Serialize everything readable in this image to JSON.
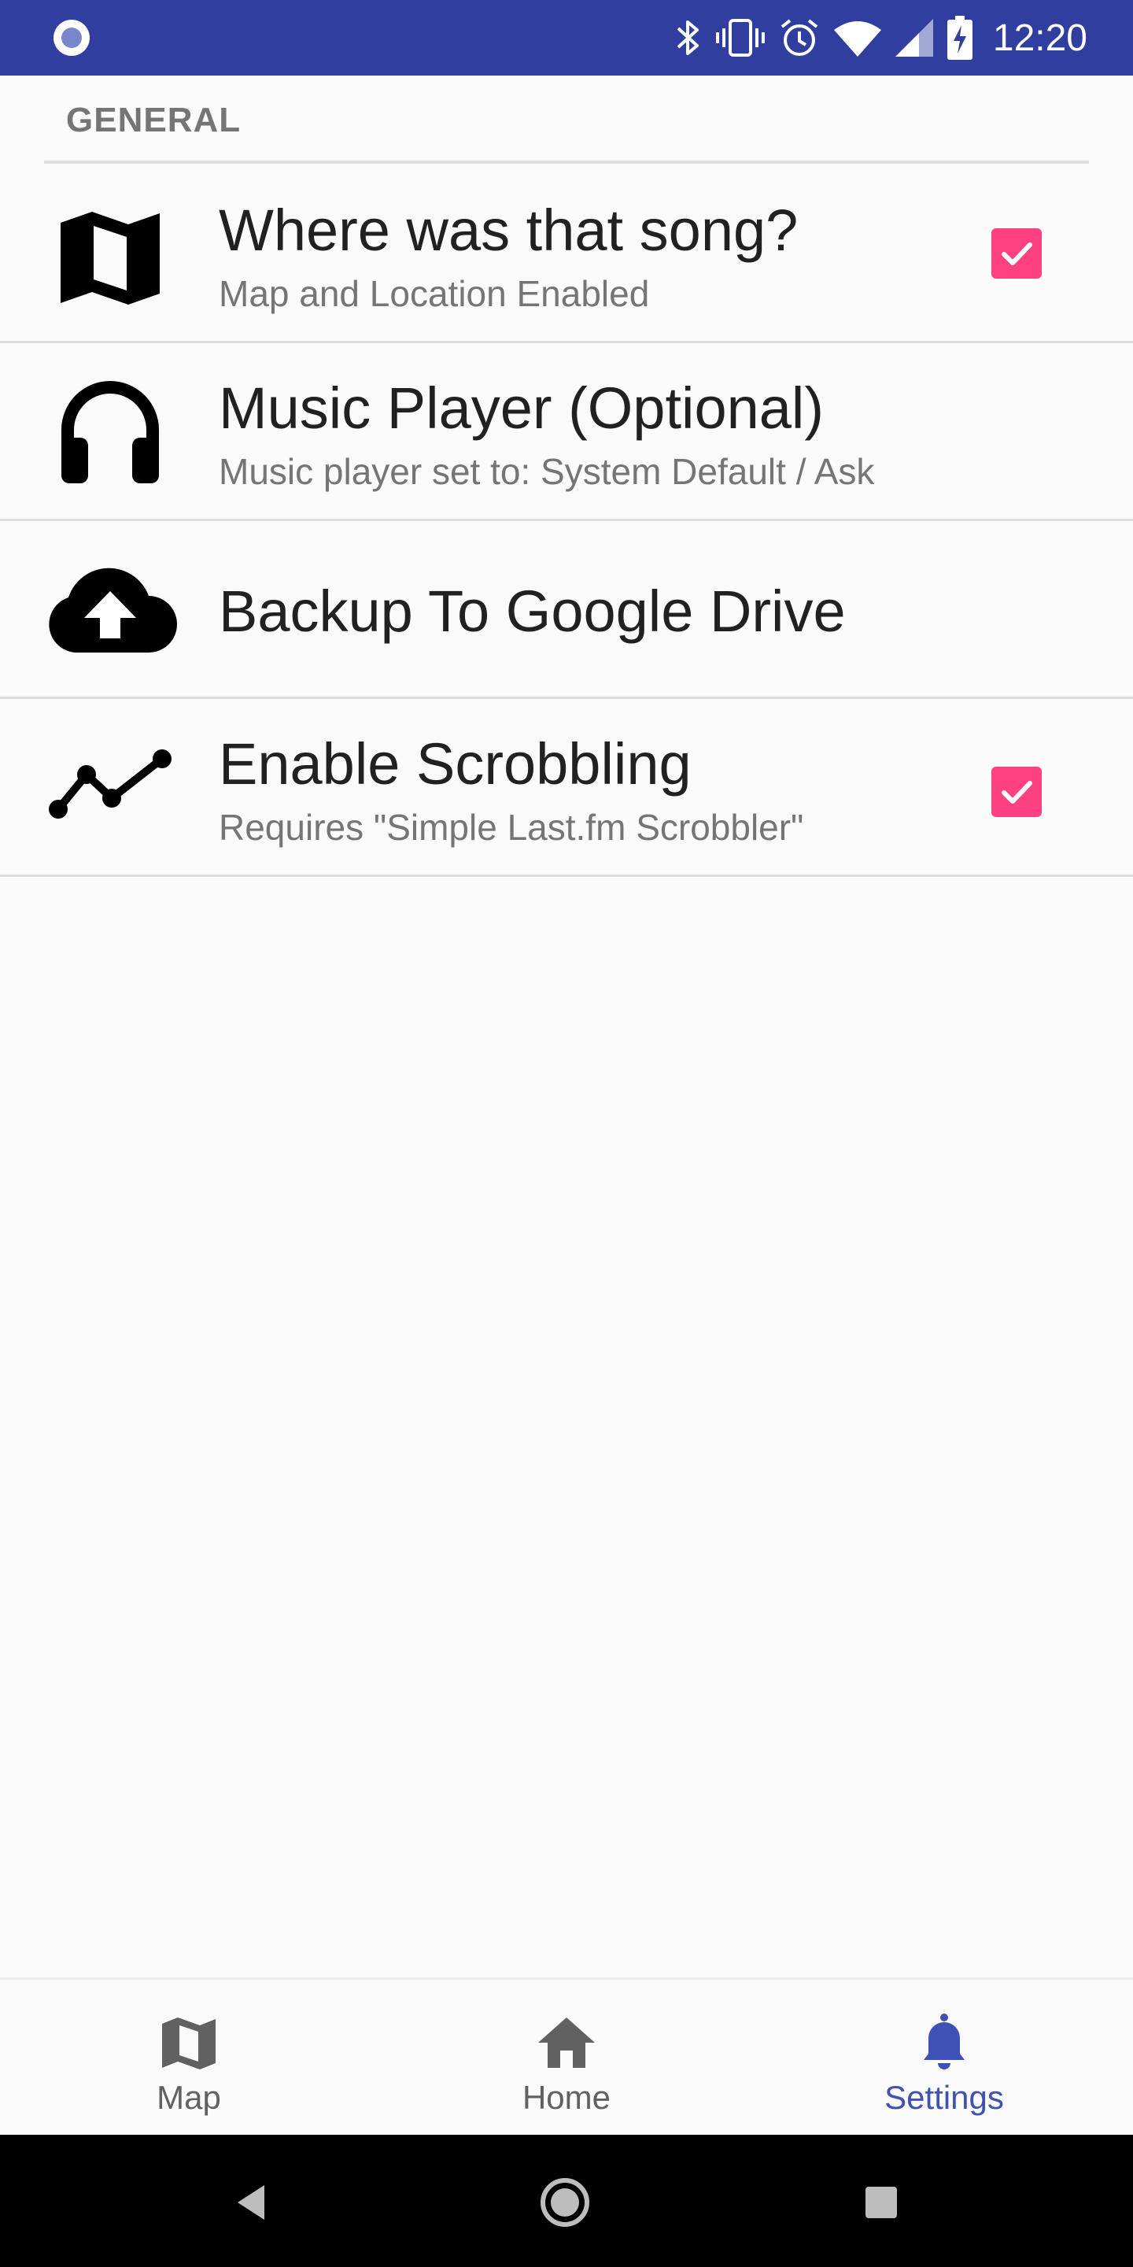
{
  "status_bar": {
    "time": "12:20",
    "background_color": "#303f9f",
    "icons": [
      "app-notification-icon",
      "bluetooth-icon",
      "vibrate-icon",
      "alarm-icon",
      "wifi-icon",
      "cell-signal-icon",
      "battery-charging-icon"
    ]
  },
  "settings": {
    "section_header": "GENERAL",
    "items": [
      {
        "title": "Where was that song?",
        "summary": "Map and Location Enabled",
        "icon": "map-icon",
        "checked": true
      },
      {
        "title": "Music Player (Optional)",
        "summary": "Music player set to: System Default / Ask",
        "icon": "headphones-icon"
      },
      {
        "title": "Backup To Google Drive",
        "icon": "cloud-upload-icon"
      },
      {
        "title": "Enable Scrobbling",
        "summary": "Requires \"Simple Last.fm Scrobbler\"",
        "icon": "trending-line-icon",
        "checked": true
      }
    ],
    "checkbox_color": "#ff4081"
  },
  "bottom_nav": {
    "items": [
      {
        "label": "Map",
        "icon": "map-icon",
        "active": false
      },
      {
        "label": "Home",
        "icon": "home-icon",
        "active": false
      },
      {
        "label": "Settings",
        "icon": "bell-icon",
        "active": true
      }
    ],
    "active_color": "#3f51b5",
    "inactive_color": "#616161"
  },
  "system_nav": {
    "buttons": [
      "back-icon",
      "home-circle-icon",
      "recents-icon"
    ]
  }
}
